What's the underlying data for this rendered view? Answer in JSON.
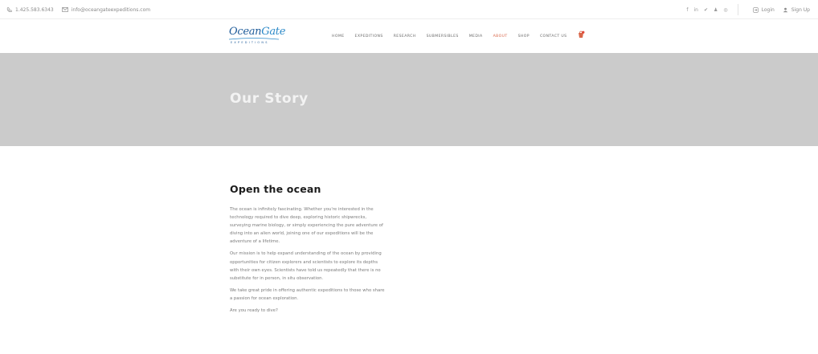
{
  "topbar": {
    "phone": "1.425.583.6343",
    "email": "info@oceangateexpeditions.com",
    "social": [
      "f",
      "in",
      "✔",
      "♟",
      "◎"
    ],
    "login": "Login",
    "signup": "Sign Up"
  },
  "header": {
    "logo_main_1": "Ocean",
    "logo_main_2": "Gate",
    "logo_sub": "EXPEDITIONS",
    "nav": [
      {
        "label": "HOME"
      },
      {
        "label": "EXPEDITIONS"
      },
      {
        "label": "RESEARCH"
      },
      {
        "label": "SUBMERSIBLES"
      },
      {
        "label": "MEDIA"
      },
      {
        "label": "ABOUT"
      },
      {
        "label": "SHOP"
      },
      {
        "label": "CONTACT US"
      }
    ]
  },
  "hero": {
    "title": "Our Story"
  },
  "main": {
    "heading": "Open the ocean",
    "paragraphs": [
      "The ocean is infinitely fascinating. Whether you're interested in the technology required to dive deep, exploring historic shipwrecks, surveying marine biology, or simply experiencing the pure adventure of diving into an alien world, joining one of our expeditions will be the adventure of a lifetime.",
      "Our mission is to help expand understanding of the ocean by providing opportunities for citizen explorers and scientists to explore its depths with their own eyes. Scientists have told us repeatedly that there is no substitute for in person, in situ observation.",
      "We take great pride in offering authentic expeditions to those who share a passion for ocean exploration.",
      "Are you ready to dive?"
    ]
  },
  "colors": {
    "accent": "#d9674a",
    "hero_bg": "#cbcbcb",
    "logo_blue": "#1f5c9a"
  }
}
